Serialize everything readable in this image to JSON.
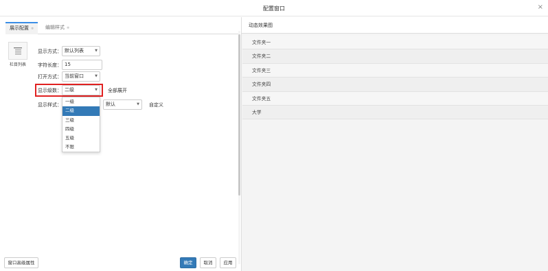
{
  "window": {
    "title": "配置窗口",
    "close": "×"
  },
  "tabs": [
    {
      "label": "展示配置",
      "caret": "≑"
    },
    {
      "label": "编辑样式",
      "caret": "≑"
    }
  ],
  "component": {
    "label": "栏目列表",
    "icon": "list-icon"
  },
  "form": {
    "display_mode": {
      "label": "显示方式：",
      "value": "默认列表"
    },
    "char_length": {
      "label": "字符长度：",
      "value": "15"
    },
    "open_mode": {
      "label": "打开方式：",
      "value": "当前窗口"
    },
    "display_level": {
      "label": "显示级数：",
      "value": "二级",
      "expand_all": "全部展开"
    },
    "display_style": {
      "label": "显示样式：",
      "value": "默认",
      "custom": "自定义"
    }
  },
  "level_options": [
    "一级",
    "二级",
    "三级",
    "四级",
    "五级",
    "不限"
  ],
  "level_selected_index": 1,
  "buttons": {
    "advanced": "窗口高级属性",
    "ok": "确定",
    "cancel": "取消",
    "apply": "应用"
  },
  "preview": {
    "title": "动态效果图",
    "items": [
      "文件夹一",
      "文件夹二",
      "文件夹三",
      "文件夹四",
      "文件夹五",
      "大学"
    ]
  },
  "colors": {
    "accent": "#337ab7",
    "highlight": "#e02020"
  }
}
